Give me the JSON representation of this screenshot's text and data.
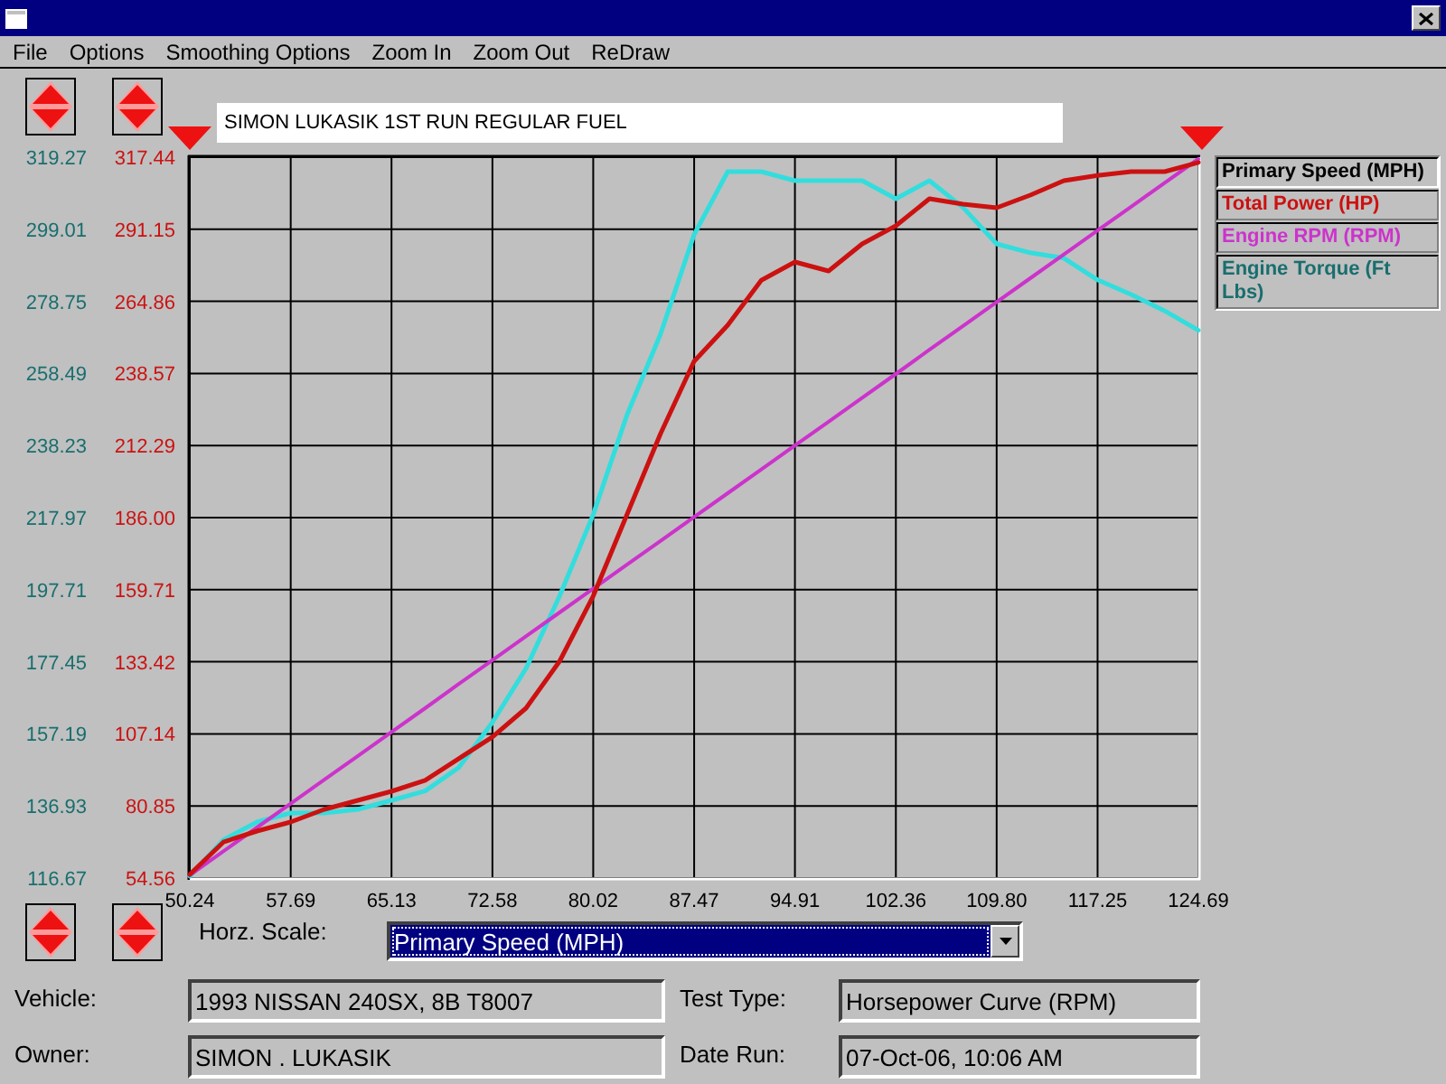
{
  "menu": [
    "File",
    "Options",
    "Smoothing Options",
    "Zoom In",
    "Zoom Out",
    "ReDraw"
  ],
  "run_title": {
    "value": "SIMON LUKASIK 1ST RUN REGULAR FUEL"
  },
  "chart": {
    "secondary_axis_labels": [
      "319.27",
      "299.01",
      "278.75",
      "258.49",
      "238.23",
      "217.97",
      "197.71",
      "177.45",
      "157.19",
      "136.93",
      "116.67"
    ],
    "chart_data": {
      "type": "line",
      "grid": true,
      "xlabel": "Primary Speed (MPH)",
      "x": [
        50.24,
        52.72,
        55.2,
        57.69,
        60.17,
        62.65,
        65.13,
        67.61,
        70.09,
        72.58,
        75.06,
        77.54,
        80.02,
        82.5,
        84.98,
        87.47,
        89.95,
        92.43,
        94.91,
        97.39,
        99.87,
        102.36,
        104.84,
        107.32,
        109.8,
        112.28,
        114.76,
        117.25,
        119.73,
        122.21,
        124.69
      ],
      "xlim": [
        50.24,
        124.69
      ],
      "ylim": [
        54.56,
        317.44
      ],
      "xticks": [
        50.24,
        57.69,
        65.13,
        72.58,
        80.02,
        87.47,
        94.91,
        102.36,
        {
          "value": 109.8,
          "label": "109.80"
        },
        117.25,
        124.69
      ],
      "yticks": [
        54.56,
        80.85,
        107.14,
        133.42,
        159.71,
        {
          "value": 186,
          "label": "186.00"
        },
        212.29,
        238.57,
        264.86,
        291.15,
        317.44
      ],
      "series": [
        {
          "name": "Total Power (HP)",
          "color": "#cc1111",
          "values": [
            55.9,
            67.7,
            71.7,
            75.0,
            79.6,
            82.9,
            86.2,
            90.2,
            98.1,
            106.0,
            116.5,
            133.6,
            157.4,
            187.0,
            216.6,
            243.0,
            256.2,
            272.6,
            279.2,
            275.9,
            285.8,
            292.4,
            302.3,
            300.3,
            299.0,
            303.6,
            308.9,
            310.8,
            312.2,
            312.2,
            315.5
          ]
        },
        {
          "name": "Engine RPM (RPM)",
          "color": "#cc33cc",
          "values": [
            55.6,
            64.3,
            73.0,
            81.7,
            90.4,
            99.1,
            107.8,
            116.5,
            125.3,
            134.0,
            142.7,
            151.4,
            160.1,
            168.8,
            177.5,
            186.2,
            194.9,
            203.6,
            212.3,
            221.0,
            229.7,
            238.4,
            247.2,
            255.9,
            264.6,
            273.3,
            282.0,
            290.7,
            299.4,
            308.1,
            316.8
          ]
        },
        {
          "name": "Engine Torque (Ft Lbs)",
          "color": "#33dddd",
          "values": [
            55.2,
            68.5,
            75.0,
            78.3,
            78.3,
            79.6,
            82.9,
            86.3,
            94.8,
            111.3,
            131.0,
            157.4,
            187.1,
            223.3,
            252.9,
            289.2,
            312.2,
            312.2,
            308.9,
            308.9,
            308.9,
            302.3,
            308.9,
            299.1,
            285.8,
            282.6,
            280.6,
            272.7,
            267.4,
            261.4,
            254.3
          ]
        }
      ]
    }
  },
  "horz_scale": {
    "label": "Horz. Scale:",
    "value": "Primary Speed (MPH)"
  },
  "details": [
    {
      "label": "Vehicle:",
      "value": "1993 NISSAN 240SX, 8B T8007"
    },
    {
      "label": "Test Type:",
      "value": "Horsepower Curve (RPM)"
    },
    {
      "label": "Owner:",
      "value": "SIMON . LUKASIK"
    },
    {
      "label": "Date Run:",
      "value": "07-Oct-06, 10:06 AM"
    }
  ]
}
